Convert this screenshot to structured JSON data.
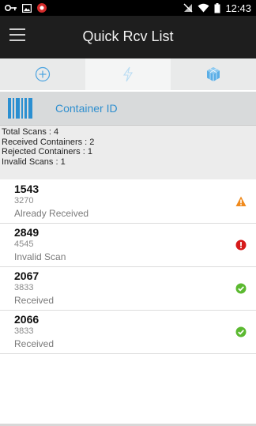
{
  "status_bar": {
    "time": "12:43",
    "icons": [
      "key-icon",
      "image-icon",
      "app-badge-icon",
      "signal-off-icon",
      "wifi-icon",
      "battery-icon"
    ]
  },
  "app_bar": {
    "title": "Quick Rcv List",
    "menu_icon": "hamburger-menu-icon"
  },
  "tabs": [
    {
      "icon": "plus-circle-icon",
      "active": false
    },
    {
      "icon": "lightning-icon",
      "active": true
    },
    {
      "icon": "cube-icon",
      "active": false
    }
  ],
  "search": {
    "label": "Container ID",
    "icon": "barcode-icon"
  },
  "summary": {
    "total_scans": "Total Scans : 4",
    "received": "Received Containers : 2",
    "rejected": "Rejected Containers : 1",
    "invalid": "Invalid Scans : 1"
  },
  "items": [
    {
      "id": "1543",
      "qty": "3270",
      "status": "Already Received",
      "icon": "warning-icon"
    },
    {
      "id": "2849",
      "qty": "4545",
      "status": "Invalid Scan",
      "icon": "error-icon"
    },
    {
      "id": "2067",
      "qty": "3833",
      "status": "Received",
      "icon": "check-icon"
    },
    {
      "id": "2066",
      "qty": "3833",
      "status": "Received",
      "icon": "check-icon"
    }
  ],
  "colors": {
    "accent": "#2b8fd1",
    "warning": "#f08a1c",
    "error": "#d61a1a",
    "success": "#5bb930",
    "appbar": "#1e1e1e"
  }
}
